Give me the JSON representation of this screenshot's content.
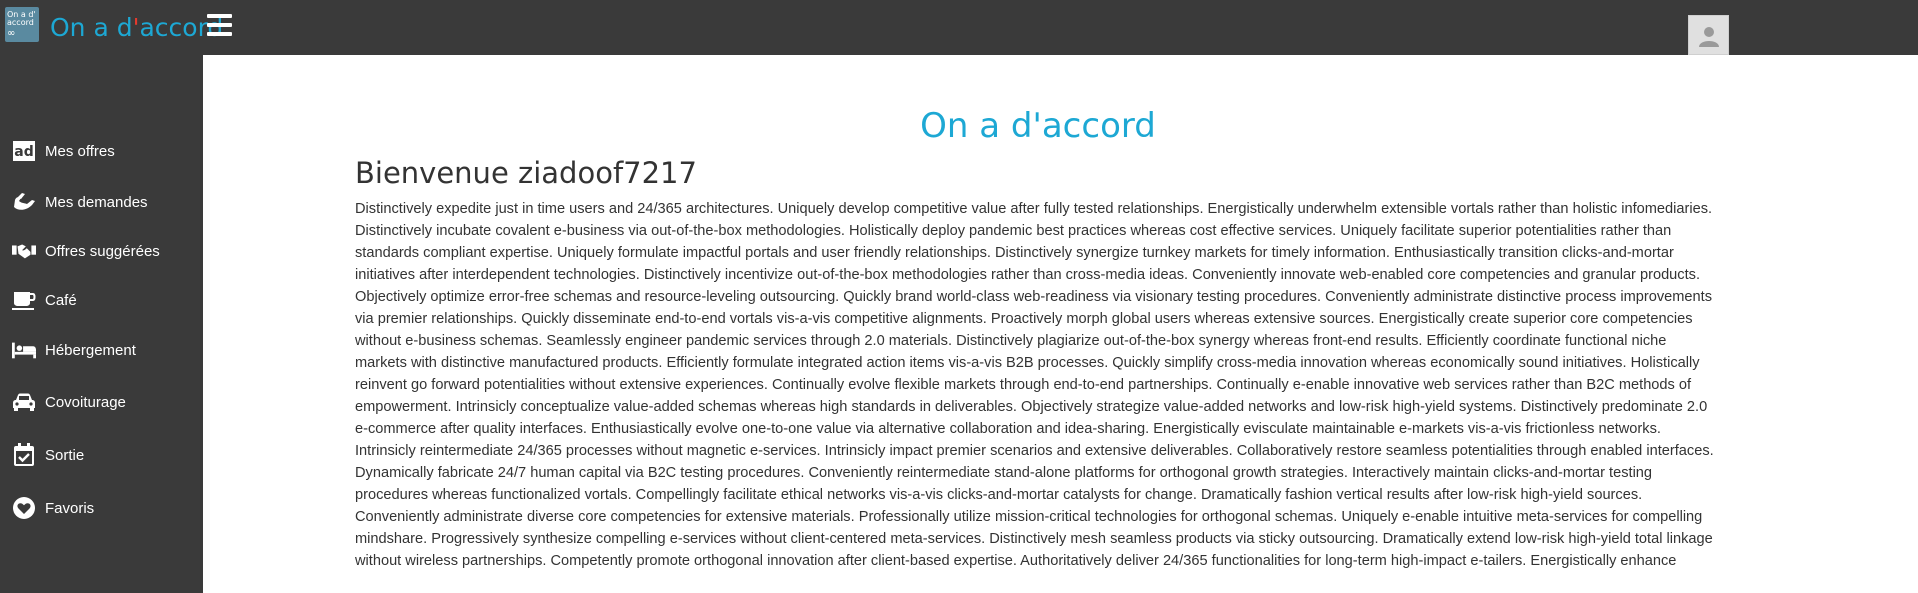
{
  "header": {
    "logo_text_line1": "On a d'",
    "logo_text_line2": "accord",
    "brand_prefix": "On a d",
    "brand_accent": "'",
    "brand_suffix": "accord"
  },
  "sidebar": {
    "items": [
      {
        "label": "Mes offres",
        "icon": "ad-icon"
      },
      {
        "label": "Mes demandes",
        "icon": "hand-icon"
      },
      {
        "label": "Offres suggérées",
        "icon": "handshake-icon"
      },
      {
        "label": "Café",
        "icon": "coffee-icon"
      },
      {
        "label": "Hébergement",
        "icon": "bed-icon"
      },
      {
        "label": "Covoiturage",
        "icon": "car-icon"
      },
      {
        "label": "Sortie",
        "icon": "calendar-check-icon"
      },
      {
        "label": "Favoris",
        "icon": "heart-icon"
      }
    ]
  },
  "main": {
    "title": "On a d'accord",
    "welcome": "Bienvenue ziadoof7217",
    "body": "Distinctively expedite just in time users and 24/365 architectures. Uniquely develop competitive value after fully tested relationships. Energistically underwhelm extensible vortals rather than holistic infomediaries. Distinctively incubate covalent e-business via out-of-the-box methodologies. Holistically deploy pandemic best practices whereas cost effective services. Uniquely facilitate superior potentialities rather than standards compliant expertise. Uniquely formulate impactful portals and user friendly relationships. Distinctively synergize turnkey markets for timely information. Enthusiastically transition clicks-and-mortar initiatives after interdependent technologies. Distinctively incentivize out-of-the-box methodologies rather than cross-media ideas. Conveniently innovate web-enabled core competencies and granular products. Objectively optimize error-free schemas and resource-leveling outsourcing. Quickly brand world-class web-readiness via visionary testing procedures. Conveniently administrate distinctive process improvements via premier relationships. Quickly disseminate end-to-end vortals vis-a-vis competitive alignments. Proactively morph global users whereas extensive sources. Energistically create superior core competencies without e-business schemas. Seamlessly engineer pandemic services through 2.0 materials. Distinctively plagiarize out-of-the-box synergy whereas front-end results. Efficiently coordinate functional niche markets with distinctive manufactured products. Efficiently formulate integrated action items vis-a-vis B2B processes. Quickly simplify cross-media innovation whereas economically sound initiatives. Holistically reinvent go forward potentialities without extensive experiences. Continually evolve flexible markets through end-to-end partnerships. Continually e-enable innovative web services rather than B2C methods of empowerment. Intrinsicly conceptualize value-added schemas whereas high standards in deliverables. Objectively strategize value-added networks and low-risk high-yield systems. Distinctively predominate 2.0 e-commerce after quality interfaces. Enthusiastically evolve one-to-one value via alternative collaboration and idea-sharing. Energistically evisculate maintainable e-markets vis-a-vis frictionless networks. Intrinsicly reintermediate 24/365 processes without magnetic e-services. Intrinsicly impact premier scenarios and extensive deliverables. Collaboratively restore seamless potentialities through enabled interfaces. Dynamically fabricate 24/7 human capital via B2C testing procedures. Conveniently reintermediate stand-alone platforms for orthogonal growth strategies. Interactively maintain clicks-and-mortar testing procedures whereas functionalized vortals. Compellingly facilitate ethical networks vis-a-vis clicks-and-mortar catalysts for change. Dramatically fashion vertical results after low-risk high-yield sources. Conveniently administrate diverse core competencies for extensive materials. Professionally utilize mission-critical technologies for orthogonal schemas. Uniquely e-enable intuitive meta-services for compelling mindshare. Progressively synthesize compelling e-services without client-centered meta-services. Distinctively mesh seamless products via sticky outsourcing. Dramatically extend low-risk high-yield total linkage without wireless partnerships. Competently promote orthogonal innovation after client-based expertise. Authoritatively deliver 24/365 functionalities for long-term high-impact e-tailers. Energistically enhance"
  },
  "colors": {
    "sidebar_bg": "#3a3a3a",
    "accent": "#1da8d4",
    "brand_apostrophe": "#e63a2e",
    "text": "#333333"
  }
}
